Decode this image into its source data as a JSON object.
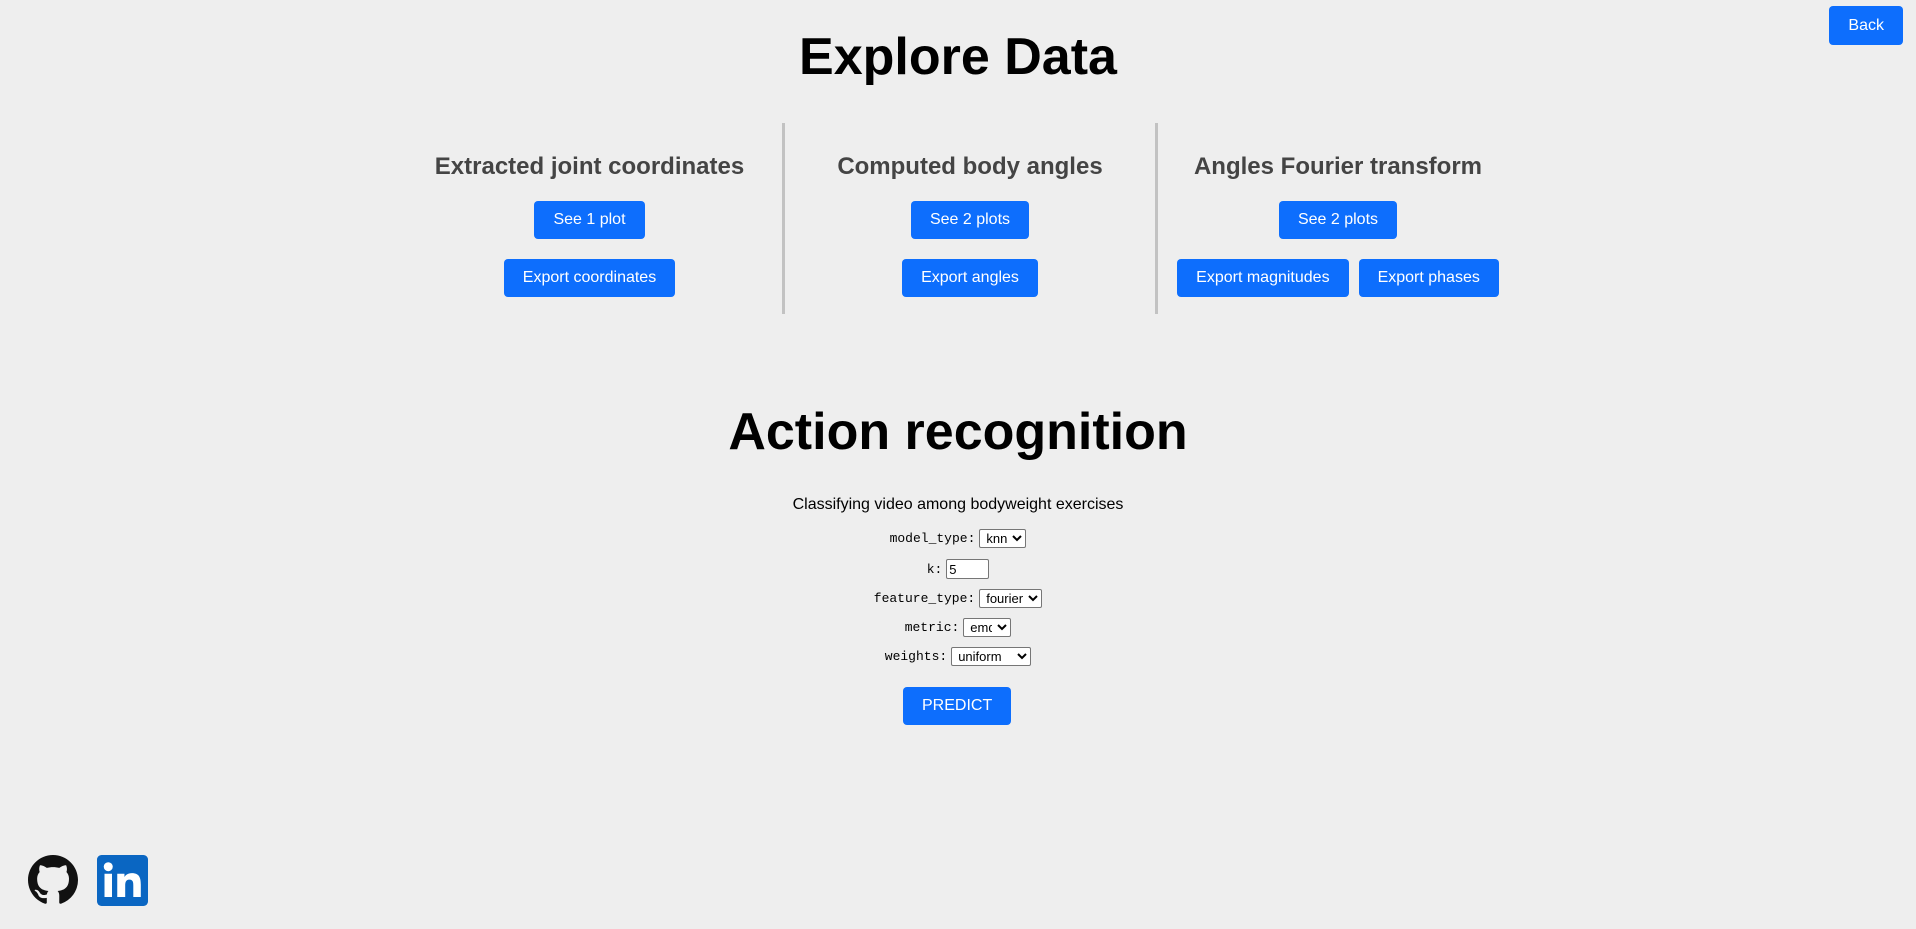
{
  "header": {
    "back_label": "Back",
    "title": "Explore Data"
  },
  "explore": {
    "columns": [
      {
        "title": "Extracted joint coordinates",
        "plot_button": "See 1 plot",
        "export_buttons": [
          "Export coordinates"
        ]
      },
      {
        "title": "Computed body angles",
        "plot_button": "See 2 plots",
        "export_buttons": [
          "Export angles"
        ]
      },
      {
        "title": "Angles Fourier transform",
        "plot_button": "See 2 plots",
        "export_buttons": [
          "Export magnitudes",
          "Export phases"
        ]
      }
    ]
  },
  "action": {
    "title": "Action recognition",
    "subtitle": "Classifying video among bodyweight exercises",
    "fields": {
      "model_type": {
        "label": "model_type:",
        "value": "knn"
      },
      "k": {
        "label": "k:",
        "value": "5"
      },
      "feature_type": {
        "label": "feature_type:",
        "value": "fourier"
      },
      "metric": {
        "label": "metric:",
        "value": "emd"
      },
      "weights": {
        "label": "weights:",
        "value": "uniform"
      }
    },
    "predict_label": "PREDICT"
  },
  "footer": {
    "icons": [
      "github-icon",
      "linkedin-icon"
    ]
  },
  "colors": {
    "background": "#eeeeee",
    "button": "#0d6efd",
    "section_title": "#444444",
    "divider": "#c2c2c2",
    "linkedin": "#0a66c2"
  }
}
